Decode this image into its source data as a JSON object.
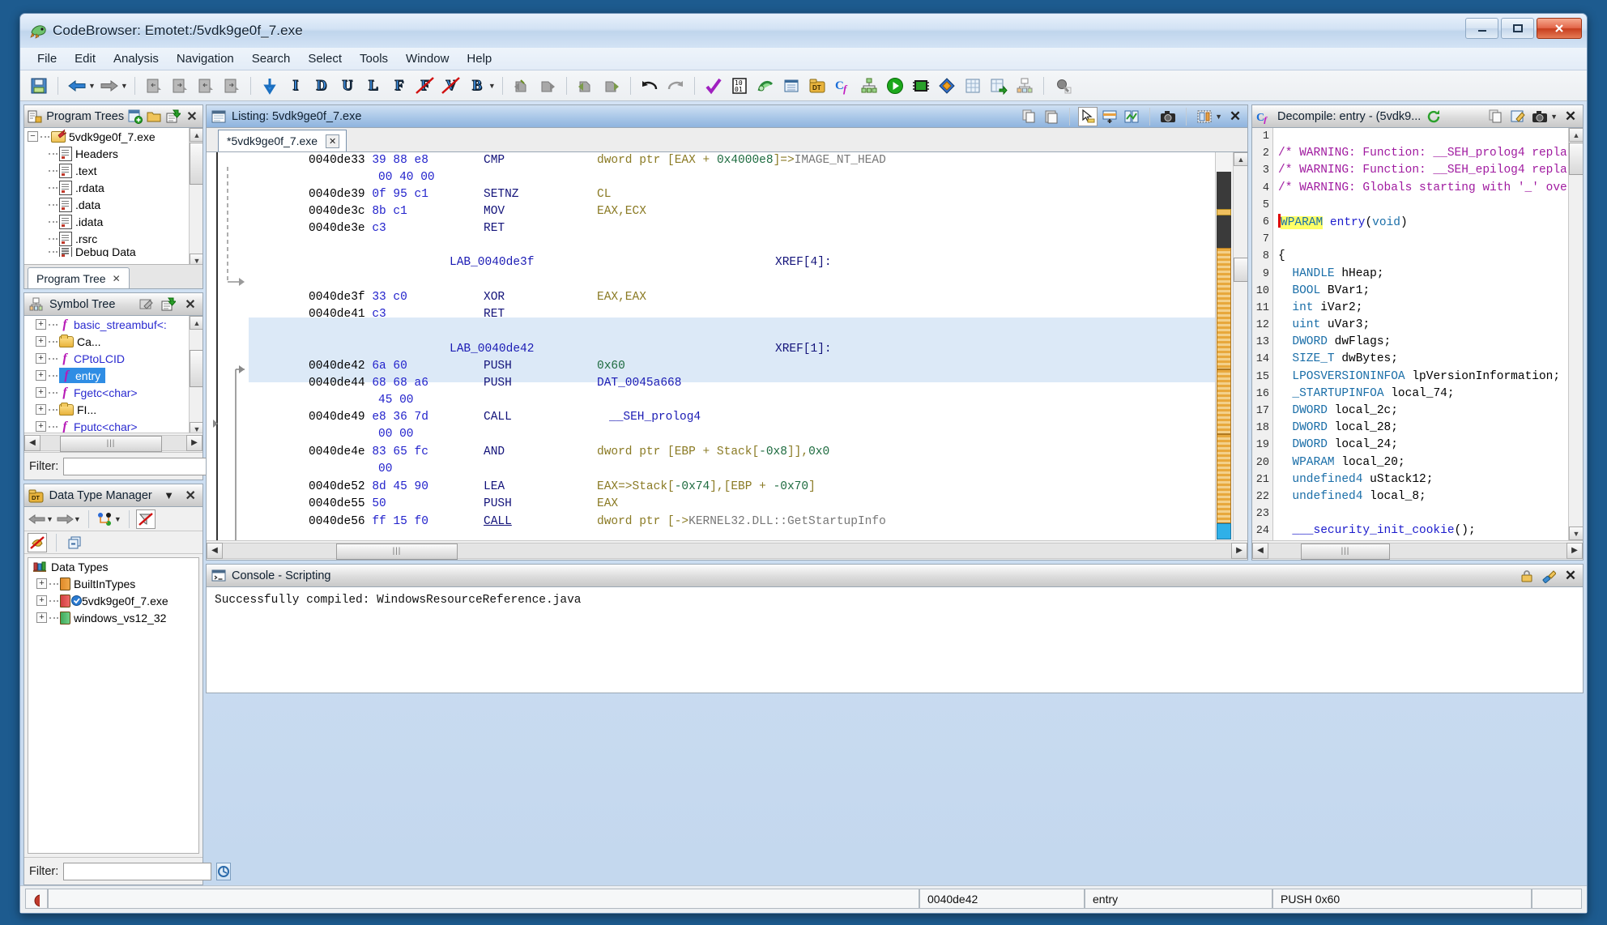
{
  "window": {
    "title": "CodeBrowser: Emotet:/5vdk9ge0f_7.exe",
    "minimize": "—",
    "maximize": "❐",
    "close": "✕"
  },
  "menubar": {
    "items": [
      "File",
      "Edit",
      "Analysis",
      "Navigation",
      "Search",
      "Select",
      "Tools",
      "Window",
      "Help"
    ]
  },
  "toolbar": {
    "groups": [
      {
        "items": [
          {
            "name": "save-icon",
            "glyph": "save"
          }
        ]
      },
      {
        "items": [
          {
            "name": "back-icon",
            "glyph": "back"
          },
          {
            "name": "back-dropdown-icon",
            "glyph": "caret"
          },
          {
            "name": "forward-icon",
            "glyph": "forward"
          },
          {
            "name": "forward-dropdown-icon",
            "glyph": "caret"
          }
        ]
      },
      {
        "items": [
          {
            "name": "previous-location-icon",
            "glyph": "page-left"
          },
          {
            "name": "next-location-icon",
            "glyph": "page-right"
          },
          {
            "name": "previous-function-icon",
            "glyph": "page-left"
          },
          {
            "name": "next-function-icon",
            "glyph": "page-right"
          }
        ]
      },
      {
        "items": [
          {
            "name": "data-down-icon",
            "glyph": "arrow-down"
          },
          {
            "name": "instruction-filter-icon",
            "glyph": "L:I"
          },
          {
            "name": "data-filter-icon",
            "glyph": "L:D"
          },
          {
            "name": "undefined-filter-icon",
            "glyph": "L:U"
          },
          {
            "name": "label-filter-icon",
            "glyph": "L:L"
          },
          {
            "name": "function-filter-icon",
            "glyph": "L:F"
          },
          {
            "name": "no-function-filter-icon",
            "glyph": "L:F-x"
          },
          {
            "name": "no-view-filter-icon",
            "glyph": "L:V-x"
          },
          {
            "name": "bookmark-filter-icon",
            "glyph": "L:B"
          },
          {
            "name": "bookmark-dropdown-icon",
            "glyph": "caret"
          }
        ]
      },
      {
        "items": [
          {
            "name": "select-block-icon",
            "glyph": "stamp"
          },
          {
            "name": "select-complement-icon",
            "glyph": "stamp"
          }
        ]
      },
      {
        "items": [
          {
            "name": "select-forward-icon",
            "glyph": "stamp"
          },
          {
            "name": "select-backward-icon",
            "glyph": "stamp"
          }
        ]
      },
      {
        "items": [
          {
            "name": "undo-icon",
            "glyph": "undo"
          },
          {
            "name": "redo-icon",
            "glyph": "redo"
          }
        ]
      },
      {
        "items": [
          {
            "name": "checkmark-icon",
            "glyph": "check"
          },
          {
            "name": "bytes-viewer-icon",
            "glyph": "bytes"
          },
          {
            "name": "function-graph-icon",
            "glyph": "graph-green"
          },
          {
            "name": "defined-data-icon",
            "glyph": "table-blue"
          },
          {
            "name": "data-type-manager-icon",
            "glyph": "folder-dt"
          },
          {
            "name": "decompiler-icon",
            "glyph": "cf"
          },
          {
            "name": "function-call-tree-icon",
            "glyph": "calltree"
          },
          {
            "name": "run-script-icon",
            "glyph": "play"
          },
          {
            "name": "memory-map-icon",
            "glyph": "chip"
          },
          {
            "name": "symbol-diamond-icon",
            "glyph": "diamond"
          },
          {
            "name": "symbol-table-icon",
            "glyph": "table"
          },
          {
            "name": "symbol-references-icon",
            "glyph": "table-arrow"
          },
          {
            "name": "symbol-tree-icon",
            "glyph": "symtree"
          }
        ]
      },
      {
        "items": [
          {
            "name": "relocation-icon",
            "glyph": "pin"
          }
        ]
      }
    ]
  },
  "program_trees": {
    "title": "Program Trees",
    "header_icons": [
      "new-tree-icon",
      "open-folder-icon",
      "paste-tree-icon"
    ],
    "close_icon": "✕",
    "nodes": [
      {
        "label": "5vdk9ge0f_7.exe",
        "icon": "folder-root-icon",
        "depth": 0,
        "expander": "−"
      },
      {
        "label": "Headers",
        "icon": "fragment-icon",
        "depth": 1,
        "expander": ""
      },
      {
        "label": ".text",
        "icon": "fragment-icon",
        "depth": 1,
        "expander": ""
      },
      {
        "label": ".rdata",
        "icon": "fragment-icon",
        "depth": 1,
        "expander": ""
      },
      {
        "label": ".data",
        "icon": "fragment-icon",
        "depth": 1,
        "expander": ""
      },
      {
        "label": ".idata",
        "icon": "fragment-icon",
        "depth": 1,
        "expander": ""
      },
      {
        "label": ".rsrc",
        "icon": "fragment-icon",
        "depth": 1,
        "expander": ""
      },
      {
        "label": "Debug Data",
        "icon": "fragment-icon",
        "depth": 1,
        "expander": ""
      }
    ],
    "tab": {
      "label": "Program Tree",
      "close": "✕"
    }
  },
  "symbol_tree": {
    "title": "Symbol Tree",
    "header_icons": [
      "edit-icon",
      "paste-tree-icon"
    ],
    "close_icon": "✕",
    "nodes": [
      {
        "label": "basic_streambuf<:",
        "icon": "function-icon",
        "selected": false
      },
      {
        "label": "Ca...",
        "icon": "folder-icon",
        "selected": false
      },
      {
        "label": "CPtoLCID",
        "icon": "function-icon",
        "selected": false
      },
      {
        "label": "entry",
        "icon": "function-icon",
        "selected": true
      },
      {
        "label": "Fgetc<char>",
        "icon": "function-icon",
        "selected": false
      },
      {
        "label": "FI...",
        "icon": "folder-icon",
        "selected": false
      },
      {
        "label": "Fputc<char>",
        "icon": "function-icon",
        "selected": false
      }
    ],
    "filter": {
      "label": "Filter:",
      "value": "",
      "placeholder": ""
    }
  },
  "data_type_manager": {
    "title": "Data Type Manager",
    "menu_icon": "▼",
    "close_icon": "✕",
    "toolbar_icons": [
      "back-icon",
      "back-dropdown-icon",
      "forward-icon",
      "forward-dropdown-icon",
      "new-datatype-icon",
      "new-dropdown-icon",
      "no-filter-icon"
    ],
    "toolbar2_icons": [
      "disable-filter-icon",
      "collapse-all-icon"
    ],
    "nodes": [
      {
        "label": "Data Types",
        "icon": "archive-root-icon",
        "depth": 0,
        "expander": ""
      },
      {
        "label": "BuiltInTypes",
        "icon": "builtin-archive-icon",
        "depth": 1,
        "expander": "+"
      },
      {
        "label": "5vdk9ge0f_7.exe",
        "icon": "program-archive-icon",
        "depth": 1,
        "expander": "+",
        "badge": "checked"
      },
      {
        "label": "windows_vs12_32",
        "icon": "file-archive-icon",
        "depth": 1,
        "expander": "+"
      }
    ],
    "filter": {
      "label": "Filter:",
      "value": "",
      "placeholder": ""
    }
  },
  "listing": {
    "title": "Listing:  5vdk9ge0f_7.exe",
    "title_icon": "listing-icon",
    "header_icons": [
      "copy-icon",
      "paste-icon",
      "cursor-icon",
      "add-view-icon",
      "diff-view-icon",
      "snapshot-icon",
      "toggle-fields-icon",
      "toggle-dropdown-icon"
    ],
    "close_icon": "✕",
    "tab": {
      "label": "*5vdk9ge0f_7.exe",
      "close": "✕"
    },
    "lines": [
      {
        "address": "0040de33",
        "bytes": "39 88 e8",
        "mnemonic": "CMP",
        "operands_raw": "dword ptr [EAX + 0x4000e8]=>IMAGE_NT_HEAD",
        "kind": "instruction",
        "highlight": false
      },
      {
        "address": "",
        "bytes": "00 40 00",
        "mnemonic": "",
        "operands_raw": "",
        "kind": "bytes-cont",
        "highlight": false
      },
      {
        "address": "0040de39",
        "bytes": "0f 95 c1",
        "mnemonic": "SETNZ",
        "operands_raw": "CL",
        "kind": "instruction",
        "highlight": false
      },
      {
        "address": "0040de3c",
        "bytes": "8b c1",
        "mnemonic": "MOV",
        "operands_raw": "EAX,ECX",
        "kind": "instruction",
        "highlight": false
      },
      {
        "address": "0040de3e",
        "bytes": "c3",
        "mnemonic": "RET",
        "operands_raw": "",
        "kind": "instruction",
        "highlight": false
      },
      {
        "address": "",
        "bytes": "",
        "mnemonic": "",
        "operands_raw": "",
        "kind": "blank",
        "highlight": false
      },
      {
        "label": "LAB_0040de3f",
        "xref": "XREF[4]:",
        "kind": "label",
        "highlight": false
      },
      {
        "address": "",
        "bytes": "",
        "mnemonic": "",
        "operands_raw": "",
        "kind": "blank",
        "highlight": false
      },
      {
        "address": "0040de3f",
        "bytes": "33 c0",
        "mnemonic": "XOR",
        "operands_raw": "EAX,EAX",
        "kind": "instruction",
        "highlight": false
      },
      {
        "address": "0040de41",
        "bytes": "c3",
        "mnemonic": "RET",
        "operands_raw": "",
        "kind": "instruction",
        "highlight": false
      },
      {
        "address": "",
        "bytes": "",
        "mnemonic": "",
        "operands_raw": "",
        "kind": "blank",
        "highlight": true
      },
      {
        "label": "LAB_0040de42",
        "xref": "XREF[1]:",
        "kind": "label",
        "highlight": true
      },
      {
        "address": "0040de42",
        "bytes": "6a 60",
        "mnemonic": "PUSH",
        "operands_raw": "0x60",
        "kind": "instruction",
        "highlight": true
      },
      {
        "address": "0040de44",
        "bytes": "68 68 a6",
        "mnemonic": "PUSH",
        "operands_raw": "DAT_0045a668",
        "kind": "instruction",
        "highlight": false
      },
      {
        "address": "",
        "bytes": "45 00",
        "mnemonic": "",
        "operands_raw": "",
        "kind": "bytes-cont",
        "highlight": false
      },
      {
        "address": "0040de49",
        "bytes": "e8 36 7d",
        "mnemonic": "CALL",
        "operands_raw": "__SEH_prolog4",
        "kind": "instruction",
        "highlight": false
      },
      {
        "address": "",
        "bytes": "00 00",
        "mnemonic": "",
        "operands_raw": "",
        "kind": "bytes-cont",
        "highlight": false
      },
      {
        "address": "0040de4e",
        "bytes": "83 65 fc",
        "mnemonic": "AND",
        "operands_raw": "dword ptr [EBP + Stack[-0x8]],0x0",
        "kind": "instruction",
        "highlight": false
      },
      {
        "address": "",
        "bytes": "00",
        "mnemonic": "",
        "operands_raw": "",
        "kind": "bytes-cont",
        "highlight": false
      },
      {
        "address": "0040de52",
        "bytes": "8d 45 90",
        "mnemonic": "LEA",
        "operands_raw": "EAX=>Stack[-0x74],[EBP + -0x70]",
        "kind": "instruction",
        "highlight": false
      },
      {
        "address": "0040de55",
        "bytes": "50",
        "mnemonic": "PUSH",
        "operands_raw": "EAX",
        "kind": "instruction",
        "highlight": false
      },
      {
        "address": "0040de56",
        "bytes": "ff 15 f0",
        "mnemonic": "CALL",
        "operands_raw": "dword ptr [->KERNEL32.DLL::GetStartupInfo",
        "kind": "instruction",
        "highlight": false
      }
    ]
  },
  "decompiler": {
    "title": "Decompile: entry -  (5vdk9...",
    "title_icon": "cf-icon",
    "header_icons": [
      "refresh-icon",
      "copy-icon",
      "edit-icon",
      "snapshot-icon",
      "menu-dropdown-icon"
    ],
    "close_icon": "✕",
    "lines": [
      {
        "n": 1,
        "text": "",
        "kind": "blank"
      },
      {
        "n": 2,
        "text": "/* WARNING: Function: __SEH_prolog4 repla",
        "kind": "warn"
      },
      {
        "n": 3,
        "text": "/* WARNING: Function: __SEH_epilog4 repla",
        "kind": "warn"
      },
      {
        "n": 4,
        "text": "/* WARNING: Globals starting with '_' ove",
        "kind": "warn"
      },
      {
        "n": 5,
        "text": "",
        "kind": "blank"
      },
      {
        "n": 6,
        "text": "WPARAM entry(void)",
        "kind": "signature",
        "highlight_token": "WPARAM"
      },
      {
        "n": 7,
        "text": "",
        "kind": "blank"
      },
      {
        "n": 8,
        "text": "{",
        "kind": "plain"
      },
      {
        "n": 9,
        "text": "  HANDLE hHeap;",
        "kind": "decl",
        "type": "HANDLE",
        "var": "hHeap"
      },
      {
        "n": 10,
        "text": "  BOOL BVar1;",
        "kind": "decl",
        "type": "BOOL",
        "var": "BVar1"
      },
      {
        "n": 11,
        "text": "  int iVar2;",
        "kind": "decl",
        "type": "int",
        "var": "iVar2"
      },
      {
        "n": 12,
        "text": "  uint uVar3;",
        "kind": "decl",
        "type": "uint",
        "var": "uVar3"
      },
      {
        "n": 13,
        "text": "  DWORD dwFlags;",
        "kind": "decl",
        "type": "DWORD",
        "var": "dwFlags"
      },
      {
        "n": 14,
        "text": "  SIZE_T dwBytes;",
        "kind": "decl",
        "type": "SIZE_T",
        "var": "dwBytes"
      },
      {
        "n": 15,
        "text": "  LPOSVERSIONINFOA lpVersionInformation;",
        "kind": "decl",
        "type": "LPOSVERSIONINFOA",
        "var": "lpVersionInformation"
      },
      {
        "n": 16,
        "text": "  _STARTUPINFOA local_74;",
        "kind": "decl",
        "type": "_STARTUPINFOA",
        "var": "local_74"
      },
      {
        "n": 17,
        "text": "  DWORD local_2c;",
        "kind": "decl",
        "type": "DWORD",
        "var": "local_2c"
      },
      {
        "n": 18,
        "text": "  DWORD local_28;",
        "kind": "decl",
        "type": "DWORD",
        "var": "local_28"
      },
      {
        "n": 19,
        "text": "  DWORD local_24;",
        "kind": "decl",
        "type": "DWORD",
        "var": "local_24"
      },
      {
        "n": 20,
        "text": "  WPARAM local_20;",
        "kind": "decl",
        "type": "WPARAM",
        "var": "local_20"
      },
      {
        "n": 21,
        "text": "  undefined4 uStack12;",
        "kind": "decl",
        "type": "undefined4",
        "var": "uStack12"
      },
      {
        "n": 22,
        "text": "  undefined4 local_8;",
        "kind": "decl",
        "type": "undefined4",
        "var": "local_8"
      },
      {
        "n": 23,
        "text": "",
        "kind": "blank"
      },
      {
        "n": 24,
        "text": "  ___security_init_cookie();",
        "kind": "call",
        "fn": "___security_init_cookie"
      }
    ]
  },
  "console": {
    "title": "Console - Scripting",
    "title_icon": "console-icon",
    "header_icons": [
      "lock-icon",
      "clear-icon"
    ],
    "close_icon": "✕",
    "output": "Successfully compiled: WindowsResourceReference.java"
  },
  "statusbar": {
    "icon": "bomb-icon",
    "address": "0040de42",
    "function": "entry",
    "instruction": "PUSH 0x60"
  },
  "colors": {
    "accent": "#2f8de4",
    "selection": "#dce9f7",
    "highlight_yellow": "#ffff66",
    "warning_purple": "#a01ba0",
    "mnemonic_blue": "#13137a",
    "operand_olive": "#8a7a23",
    "number_green": "#1d6b3f",
    "bytes_blue": "#2222cc"
  }
}
